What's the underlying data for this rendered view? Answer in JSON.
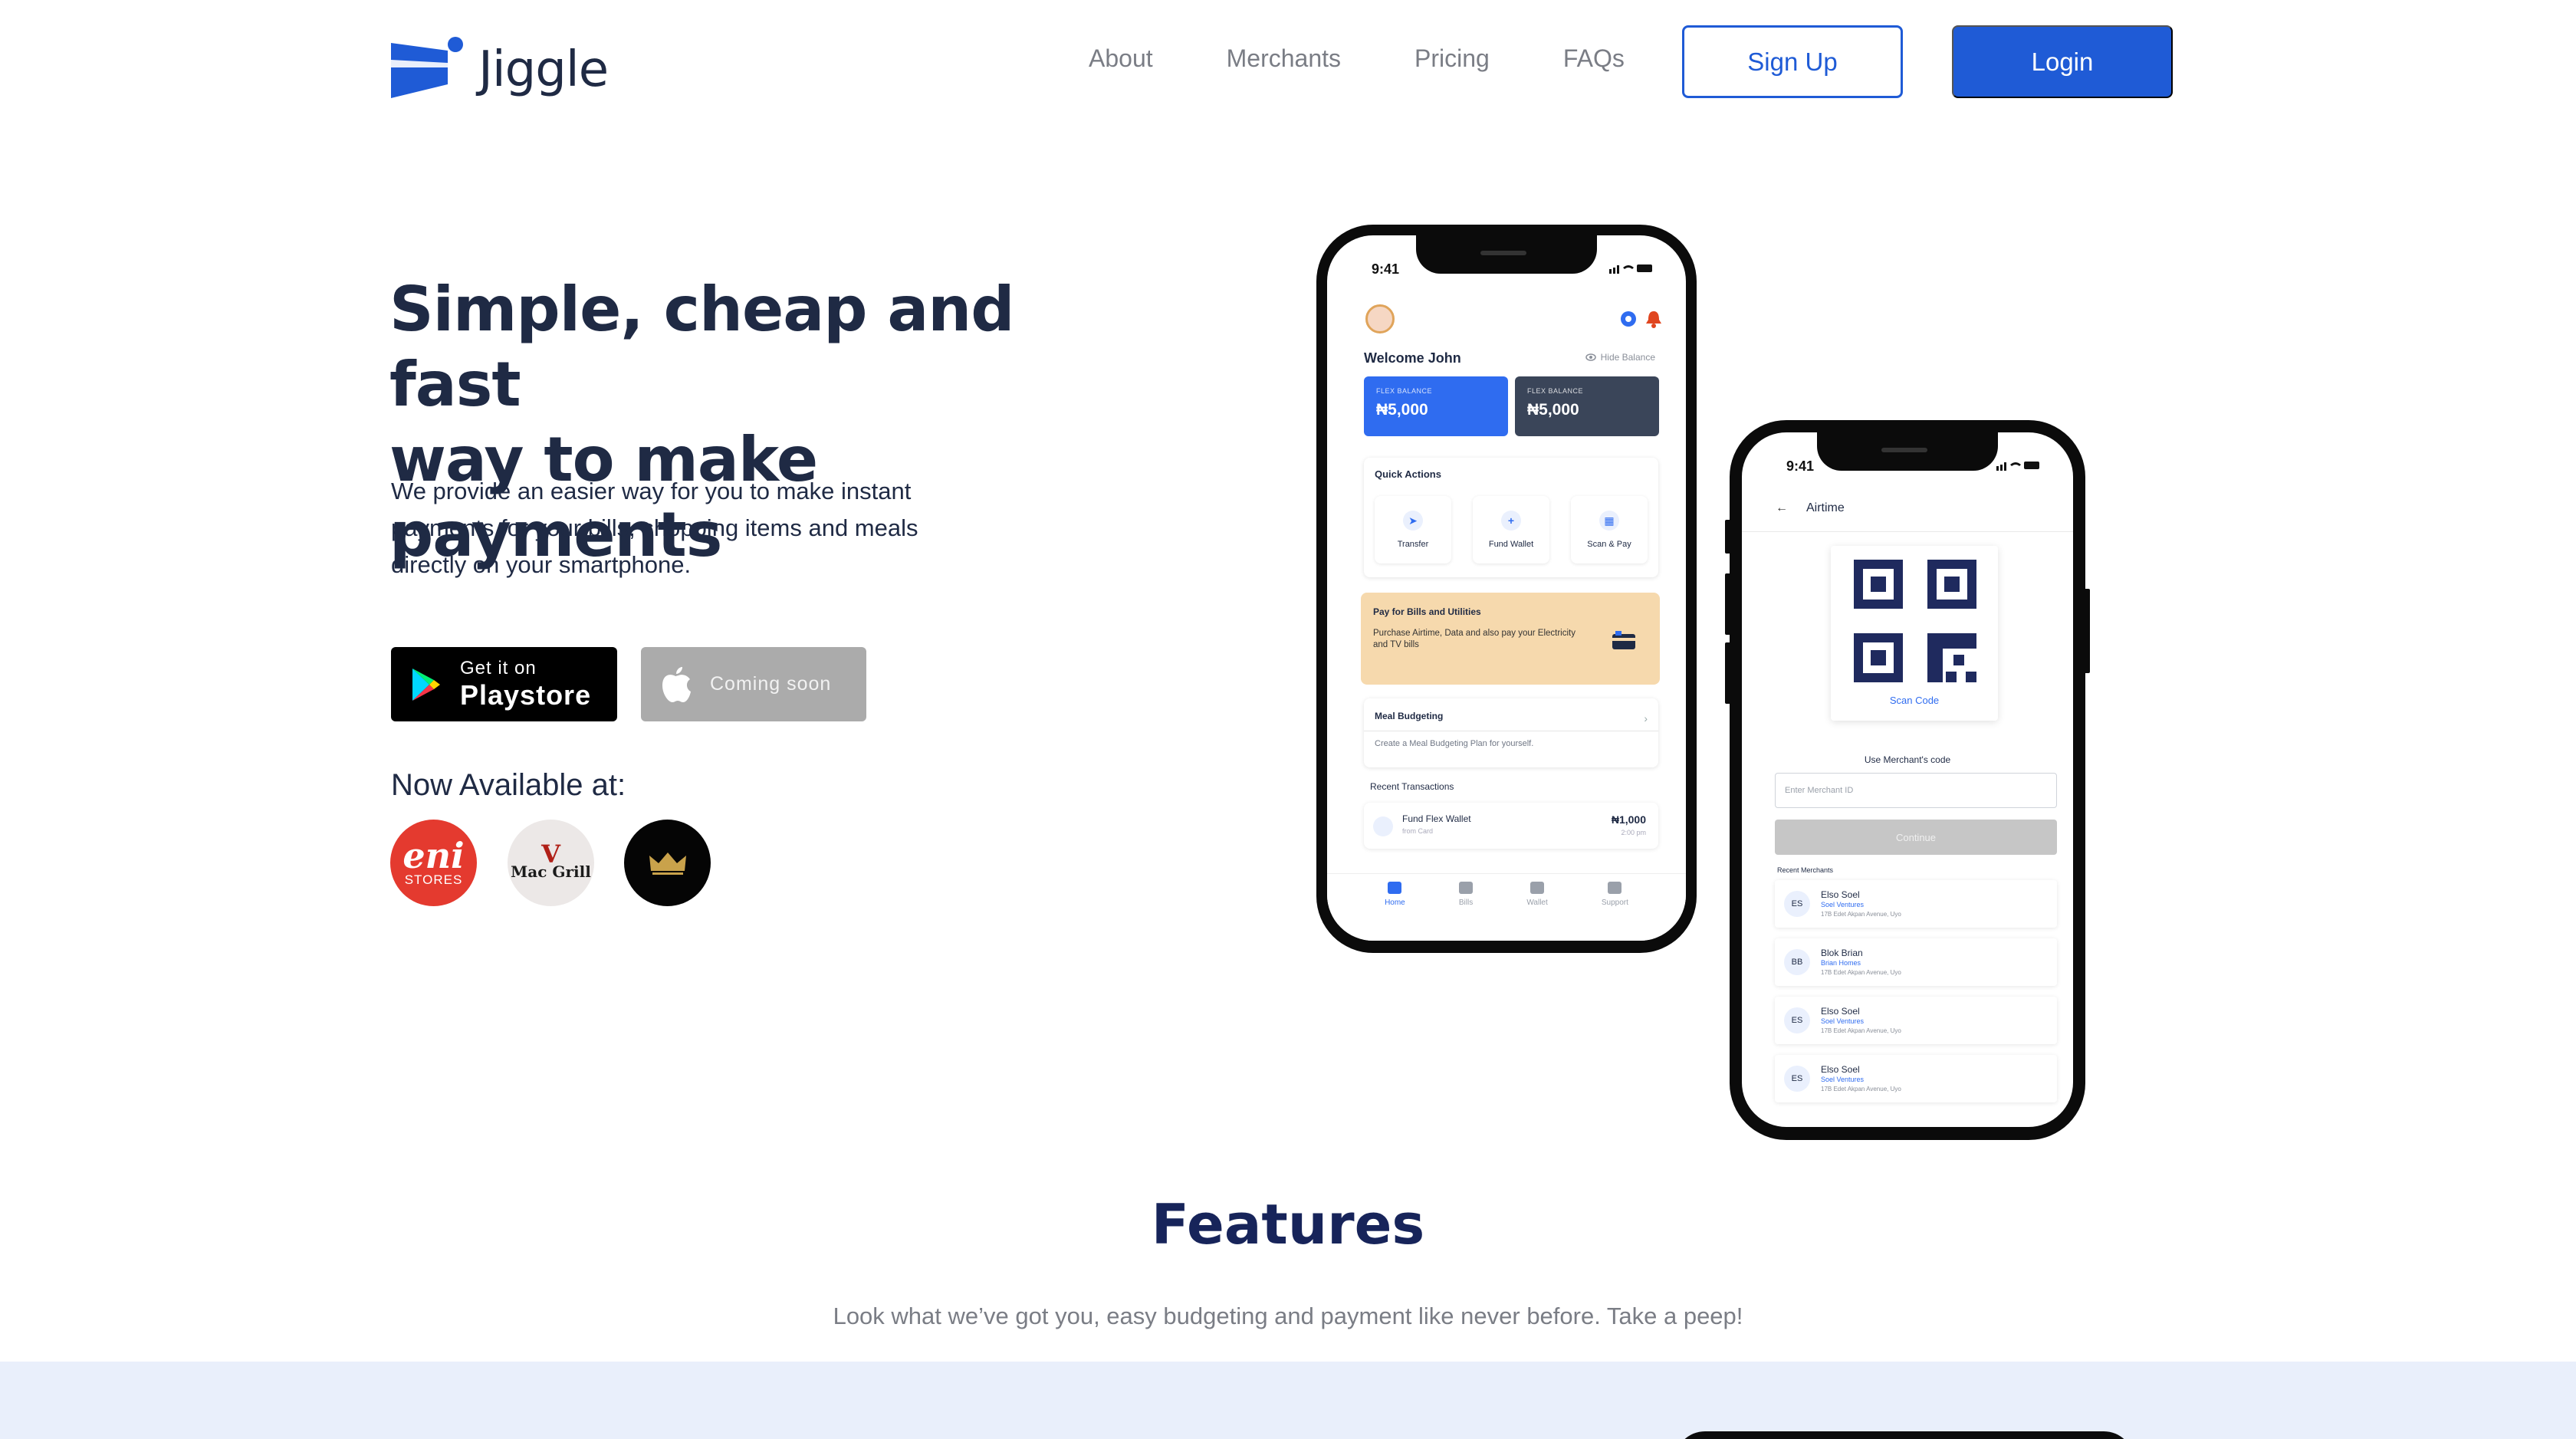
{
  "brand": {
    "name": "Jiggle",
    "primary_color": "#1f5bd6",
    "text_color": "#1f2a44"
  },
  "nav": {
    "links": [
      "About",
      "Merchants",
      "Pricing",
      "FAQs"
    ],
    "signup_label": "Sign Up",
    "login_label": "Login"
  },
  "hero": {
    "title_line1": "Simple, cheap and fast",
    "title_line2": "way to make payments",
    "subtitle_line1": "We provide an easier way for you to make instant",
    "subtitle_line2": "payments for your bills, shopping items and meals",
    "subtitle_line3": "directly on your smartphone.",
    "playstore": {
      "small": "Get it on",
      "big": "Playstore",
      "icon": "google-play-icon"
    },
    "appstore": {
      "label": "Coming soon",
      "icon": "apple-icon"
    },
    "available_title": "Now Available at:",
    "merchants": [
      {
        "name": "eni",
        "sub": "STORES"
      },
      {
        "name_a": "Mac",
        "name_b": "Grill"
      },
      {
        "name": "crown-logo"
      }
    ]
  },
  "phone_home": {
    "time": "9:41",
    "welcome": "Welcome John",
    "hide_balance": "Hide Balance",
    "cards": [
      {
        "label": "FLEX BALANCE",
        "amount": "₦5,000"
      },
      {
        "label": "FLEX BALANCE",
        "amount": "₦5,000"
      }
    ],
    "quick_actions_title": "Quick Actions",
    "quick_actions": [
      "Transfer",
      "Fund Wallet",
      "Scan & Pay"
    ],
    "bills_title": "Pay for Bills and Utilities",
    "bills_desc": "Purchase Airtime, Data and also pay your Electricity and TV bills",
    "budget_title": "Meal Budgeting",
    "budget_desc": "Create a Meal Budgeting Plan for yourself.",
    "recent_title": "Recent Transactions",
    "transaction": {
      "name": "Fund Flex Wallet",
      "sub": "from Card",
      "amount": "₦1,000",
      "time": "2:00 pm"
    },
    "tabs": [
      "Home",
      "Bills",
      "Wallet",
      "Support"
    ]
  },
  "phone_airtime": {
    "time": "9:41",
    "title": "Airtime",
    "scan_label": "Scan Code",
    "use_code": "Use Merchant's code",
    "merchant_placeholder": "Enter Merchant ID",
    "continue_label": "Continue",
    "recent_title": "Recent Merchants",
    "merchants": [
      {
        "initials": "ES",
        "name": "Elso Soel",
        "biz": "Soel Ventures",
        "addr": "17B Edet Akpan Avenue, Uyo"
      },
      {
        "initials": "BB",
        "name": "Blok Brian",
        "biz": "Brian Homes",
        "addr": "17B Edet Akpan Avenue, Uyo"
      },
      {
        "initials": "ES",
        "name": "Elso Soel",
        "biz": "Soel Ventures",
        "addr": "17B Edet Akpan Avenue, Uyo"
      },
      {
        "initials": "ES",
        "name": "Elso Soel",
        "biz": "Soel Ventures",
        "addr": "17B Edet Akpan Avenue, Uyo"
      }
    ]
  },
  "features": {
    "title": "Features",
    "subtitle": "Look what we’ve got you, easy budgeting and payment like never before. Take a peep!"
  }
}
